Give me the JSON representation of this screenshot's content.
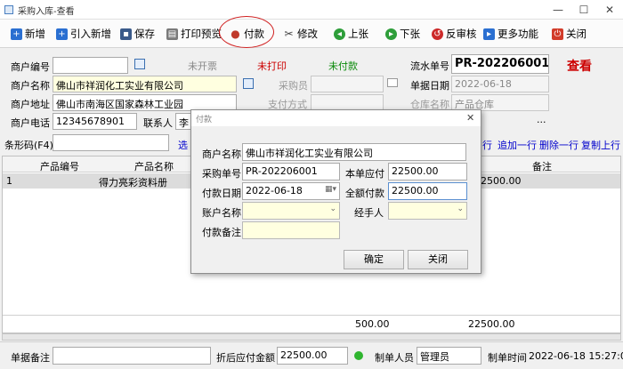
{
  "window": {
    "title": "采购入库-查看",
    "minimize": "—",
    "maximize": "☐",
    "close": "✕"
  },
  "toolbar": {
    "new": "新增",
    "import_new": "引入新增",
    "save": "保存",
    "print_preview": "打印预览",
    "pay": "付款",
    "edit": "修改",
    "prev": "上张",
    "next": "下张",
    "unaudit": "反审核",
    "more": "更多功能",
    "close": "关闭"
  },
  "form": {
    "vendor_code_label": "商户编号",
    "vendor_code": "",
    "status_invoice": "未开票",
    "status_print": "未打印",
    "status_pay": "未付款",
    "serial_label": "流水单号",
    "serial": "PR-202206001",
    "view_mark": "查看",
    "vendor_name_label": "商户名称",
    "vendor_name": "佛山市祥润化工实业有限公司",
    "buyer_label": "采购员",
    "buyer": "",
    "doc_date_label": "单据日期",
    "doc_date": "2022-06-18",
    "address_label": "商户地址",
    "address": "佛山市南海区国家森林工业园",
    "pay_method_label": "支付方式",
    "pay_method": "",
    "warehouse_label": "仓库名称",
    "warehouse": "产品仓库",
    "phone_label": "商户电话",
    "phone": "12345678901",
    "contact_label": "联系人",
    "contact": "李"
  },
  "barcode": {
    "label": "条形码(F4)",
    "value": "",
    "select_link": "选",
    "links": [
      "行",
      "追加一行",
      "删除一行",
      "复制上行"
    ]
  },
  "grid": {
    "headers": [
      "产品编号",
      "产品名称",
      "",
      "备注"
    ],
    "rows": [
      {
        "no": "1",
        "code": "",
        "name": "得力亮彩资料册",
        "amount": "22500.00",
        "note": ""
      }
    ],
    "total_qty": "500.00",
    "total_amount": "22500.00"
  },
  "dialog": {
    "title": "付款",
    "vendor_label": "商户名称",
    "vendor": "佛山市祥润化工实业有限公司",
    "po_label": "采购单号",
    "po": "PR-202206001",
    "due_label": "本单应付",
    "due": "22500.00",
    "date_label": "付款日期",
    "date": "2022-06-18",
    "full_label": "全额付款",
    "full": "22500.00",
    "account_label": "账户名称",
    "account": "",
    "handler_label": "经手人",
    "handler": "",
    "remark_label": "付款备注",
    "remark": "",
    "ok": "确定",
    "cancel": "关闭"
  },
  "status": {
    "note_label": "单据备注",
    "note": "",
    "discount_label": "折后应付金额",
    "discount": "22500.00",
    "maker_label": "制单人员",
    "maker": "管理员",
    "time_label": "制单时间",
    "time": "2022-06-18 15:27:04"
  },
  "colors": {
    "accent_red": "#cc0000",
    "status_green": "#0a8a0a",
    "link_blue": "#0000cc"
  }
}
